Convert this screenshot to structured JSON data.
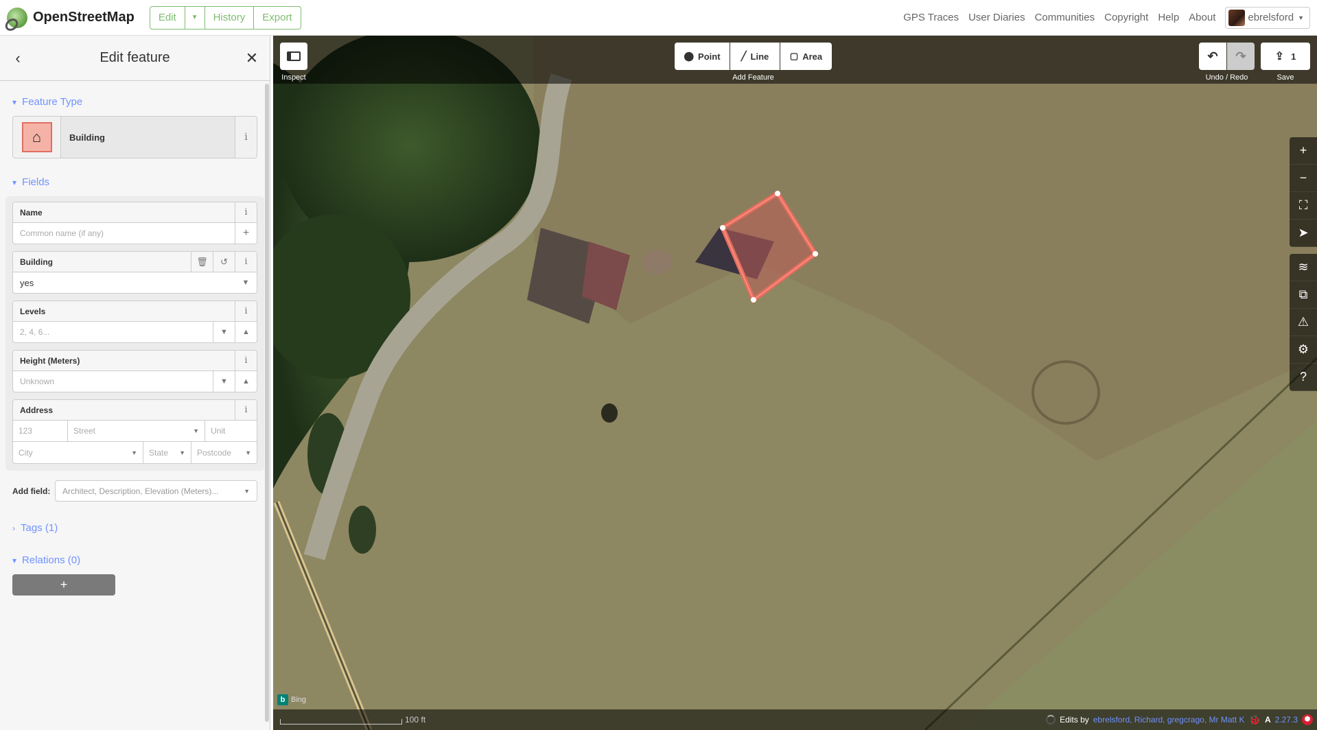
{
  "nav": {
    "brand": "OpenStreetMap",
    "edit": "Edit",
    "history": "History",
    "export": "Export",
    "links": [
      "GPS Traces",
      "User Diaries",
      "Communities",
      "Copyright",
      "Help",
      "About"
    ],
    "user": "ebrelsford"
  },
  "sidebar": {
    "title": "Edit feature",
    "feature_type_heading": "Feature Type",
    "feature_type": "Building",
    "fields_heading": "Fields",
    "name_label": "Name",
    "name_placeholder": "Common name (if any)",
    "building_label": "Building",
    "building_value": "yes",
    "levels_label": "Levels",
    "levels_placeholder": "2, 4, 6...",
    "height_label": "Height (Meters)",
    "height_placeholder": "Unknown",
    "address_label": "Address",
    "address": {
      "housenumber": "123",
      "street": "Street",
      "unit": "Unit",
      "city": "City",
      "state": "State",
      "postcode": "Postcode"
    },
    "add_field_label": "Add field:",
    "add_field_placeholder": "Architect, Description, Elevation (Meters)...",
    "tags_heading": "Tags (1)",
    "relations_heading": "Relations (0)",
    "add_relation": "+"
  },
  "toolbar": {
    "inspect": "Inspect",
    "point": "Point",
    "line": "Line",
    "area": "Area",
    "add_feature": "Add Feature",
    "undo_redo": "Undo / Redo",
    "save_count": "1",
    "save": "Save"
  },
  "footer": {
    "imagery": "Bing",
    "scale": "100 ft",
    "edits_by_prefix": "Edits by",
    "editors": "ebrelsford, Richard, gregcrago, Mr Matt K",
    "version": "2.27.3"
  },
  "colors": {
    "accent": "#7092ff",
    "osm_green": "#7ebc6f",
    "selected_area": "#e06e5f"
  }
}
